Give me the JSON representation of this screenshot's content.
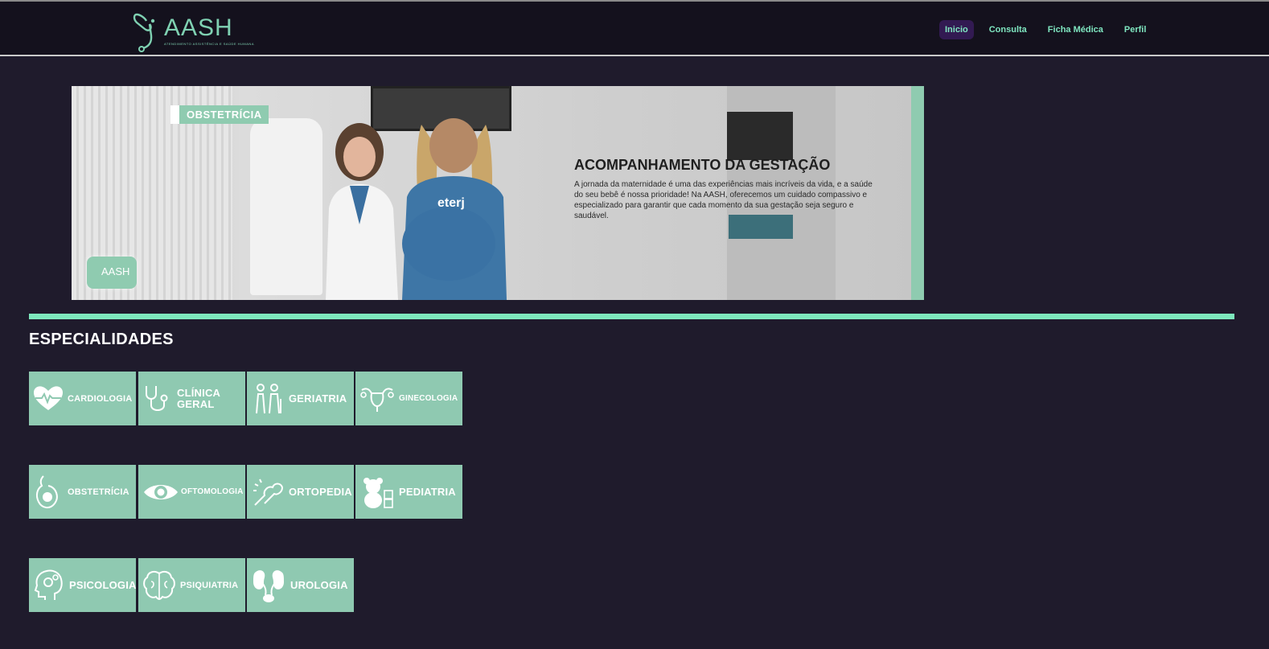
{
  "header": {
    "logo_text": "AASH",
    "logo_tagline": "ATENDIMENTO ASSISTÊNCIA E SAÚDE HUMANA",
    "nav": [
      {
        "label": "Inicio",
        "active": true
      },
      {
        "label": "Consulta",
        "active": false
      },
      {
        "label": "Ficha Médica",
        "active": false
      },
      {
        "label": "Perfil",
        "active": false
      }
    ]
  },
  "banner": {
    "tag": "OBSTETRÍCIA",
    "title": "ACOMPANHAMENTO DA GESTAÇÃO",
    "text": "A jornada da maternidade é uma das experiências mais incríveis da vida, e a saúde do seu bebê é nossa prioridade! Na AASH, oferecemos um cuidado compassivo e especializado para garantir que cada momento da sua gestação seja seguro e saudável.",
    "logo": "AASH",
    "shirt_text": "eterj"
  },
  "specialties": {
    "title": "ESPECIALIDADES",
    "items": [
      {
        "label": "CARDIOLOGIA",
        "icon": "heart-pulse-icon"
      },
      {
        "label": "CLÍNICA GERAL",
        "icon": "stethoscope-icon"
      },
      {
        "label": "GERIATRIA",
        "icon": "elderly-icon"
      },
      {
        "label": "GINECOLOGIA",
        "icon": "uterus-icon"
      },
      {
        "label": "OBSTETRÍCIA",
        "icon": "pregnancy-icon"
      },
      {
        "label": "OFTOMOLOGIA",
        "icon": "eye-icon"
      },
      {
        "label": "ORTOPEDIA",
        "icon": "bone-joint-icon"
      },
      {
        "label": "PEDIATRIA",
        "icon": "teddy-bear-icon"
      },
      {
        "label": "PSICOLOGIA",
        "icon": "head-gears-icon"
      },
      {
        "label": "PSIQUIATRIA",
        "icon": "brain-icon"
      },
      {
        "label": "UROLOGIA",
        "icon": "kidneys-icon"
      }
    ]
  },
  "colors": {
    "background": "#1f1b2c",
    "navbar": "#14111d",
    "accent": "#7de8bd",
    "card": "#8fc9b1",
    "nav_active": "#321a52"
  }
}
